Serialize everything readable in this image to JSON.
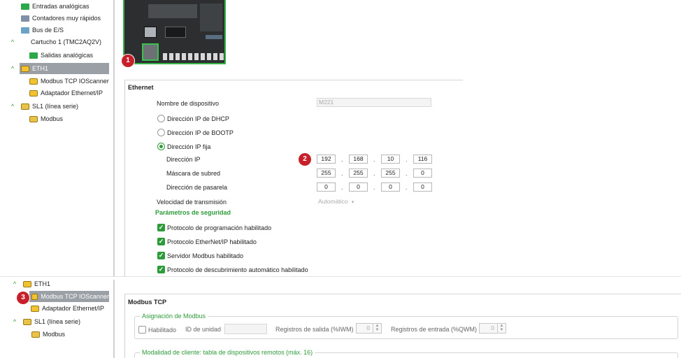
{
  "tree_top": {
    "items": [
      {
        "label": "Entradas analógicas"
      },
      {
        "label": "Contadores muy rápidos"
      },
      {
        "label": "Bus de E/S"
      },
      {
        "label": "Cartucho 1 (TMC2AQ2V)"
      },
      {
        "label": "Salidas analógicas"
      },
      {
        "label": "ETH1"
      },
      {
        "label": "Modbus TCP IOScanner"
      },
      {
        "label": "Adaptador Ethernet/IP"
      },
      {
        "label": "SL1 (línea serie)"
      },
      {
        "label": "Modbus"
      }
    ]
  },
  "tree_bottom": {
    "items": [
      {
        "label": "ETH1"
      },
      {
        "label": "Modbus TCP IOScanner"
      },
      {
        "label": "Adaptador Ethernet/IP"
      },
      {
        "label": "SL1 (línea serie)"
      },
      {
        "label": "Modbus"
      }
    ]
  },
  "badges": {
    "b1": "1",
    "b2": "2",
    "b3": "3"
  },
  "ethernet": {
    "section_title": "Ethernet",
    "device_name_label": "Nombre de dispositivo",
    "device_name_value": "M221",
    "ip_dhcp": "Dirección IP de DHCP",
    "ip_bootp": "Dirección IP de BOOTP",
    "ip_fixed": "Dirección IP fija",
    "ip_label": "Dirección IP",
    "ip": [
      "192",
      "168",
      "10",
      "116"
    ],
    "mask_label": "Máscara de subred",
    "mask": [
      "255",
      "255",
      "255",
      "0"
    ],
    "gateway_label": "Dirección de pasarela",
    "gateway": [
      "0",
      "0",
      "0",
      "0"
    ],
    "speed_label": "Velocidad de transmisión",
    "speed_value": "Automático",
    "security_title": "Parámetros de seguridad",
    "checks": [
      {
        "label": "Protocolo de programación habilitado"
      },
      {
        "label": "Protocolo EtherNet/IP habilitado"
      },
      {
        "label": "Servidor Modbus habilitado"
      },
      {
        "label": "Protocolo de descubrimiento automático habilitado"
      }
    ]
  },
  "modbus": {
    "section_title": "Modbus TCP",
    "assign_title": "Asignación de Modbus",
    "enabled_label": "Habilitado",
    "unit_id_label": "ID de unidad",
    "out_regs_label": "Registros de salida (%IWM)",
    "out_regs_value": "0",
    "in_regs_label": "Registros de entrada (%QWM)",
    "in_regs_value": "0",
    "client_title": "Modalidad de cliente: tabla de dispositivos remotos (máx. 16)"
  },
  "colors": {
    "accent": "#2e9b3a",
    "badge": "#c8202a",
    "selection": "#9aa0a6"
  }
}
